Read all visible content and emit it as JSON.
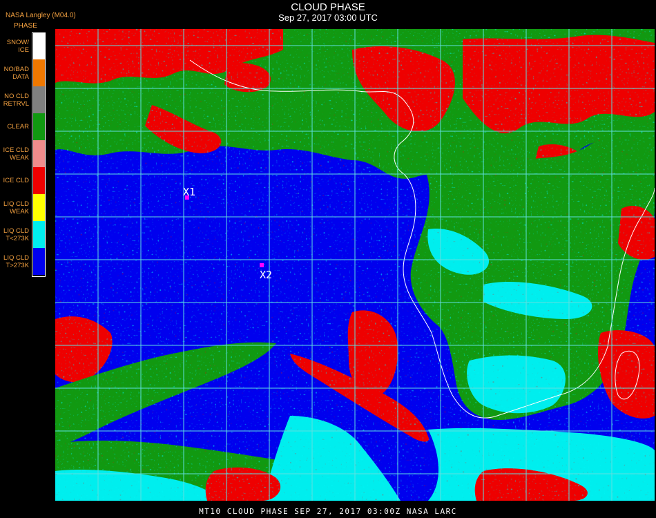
{
  "header": {
    "agency": "NASA Langley (M04.0)",
    "title": "CLOUD PHASE",
    "subtitle": "Sep 27, 2017 03:00 UTC"
  },
  "legend": {
    "title": "PHASE",
    "items": [
      {
        "line1": "SNOW/",
        "line2": "ICE",
        "color": "#ffffff"
      },
      {
        "line1": "NO/BAD",
        "line2": "DATA",
        "color": "#f07800"
      },
      {
        "line1": "NO CLD",
        "line2": "RETRVL",
        "color": "#808080"
      },
      {
        "line1": "CLEAR",
        "line2": "",
        "color": "#119911"
      },
      {
        "line1": "ICE CLD",
        "line2": "WEAK",
        "color": "#f08c8c"
      },
      {
        "line1": "ICE CLD",
        "line2": "",
        "color": "#ee0000"
      },
      {
        "line1": "LIQ CLD",
        "line2": "WEAK",
        "color": "#ffff00"
      },
      {
        "line1": "LIQ CLD",
        "line2": "T<273K",
        "color": "#00eeee"
      },
      {
        "line1": "LIQ CLD",
        "line2": "T>273K",
        "color": "#0000ee"
      }
    ]
  },
  "markers": [
    {
      "label": "X1"
    },
    {
      "label": "X2"
    }
  ],
  "colors": {
    "grid": "#5fe0e0",
    "coast": "#ffffff",
    "marker": "#ff00ff",
    "ocean_liquid": "#0000ee",
    "ice": "#ee0000",
    "clear": "#119911",
    "liquid_cold": "#00eeee"
  },
  "footer": {
    "text": "MT10  CLOUD PHASE   SEP 27, 2017 03:00Z   NASA LARC"
  }
}
